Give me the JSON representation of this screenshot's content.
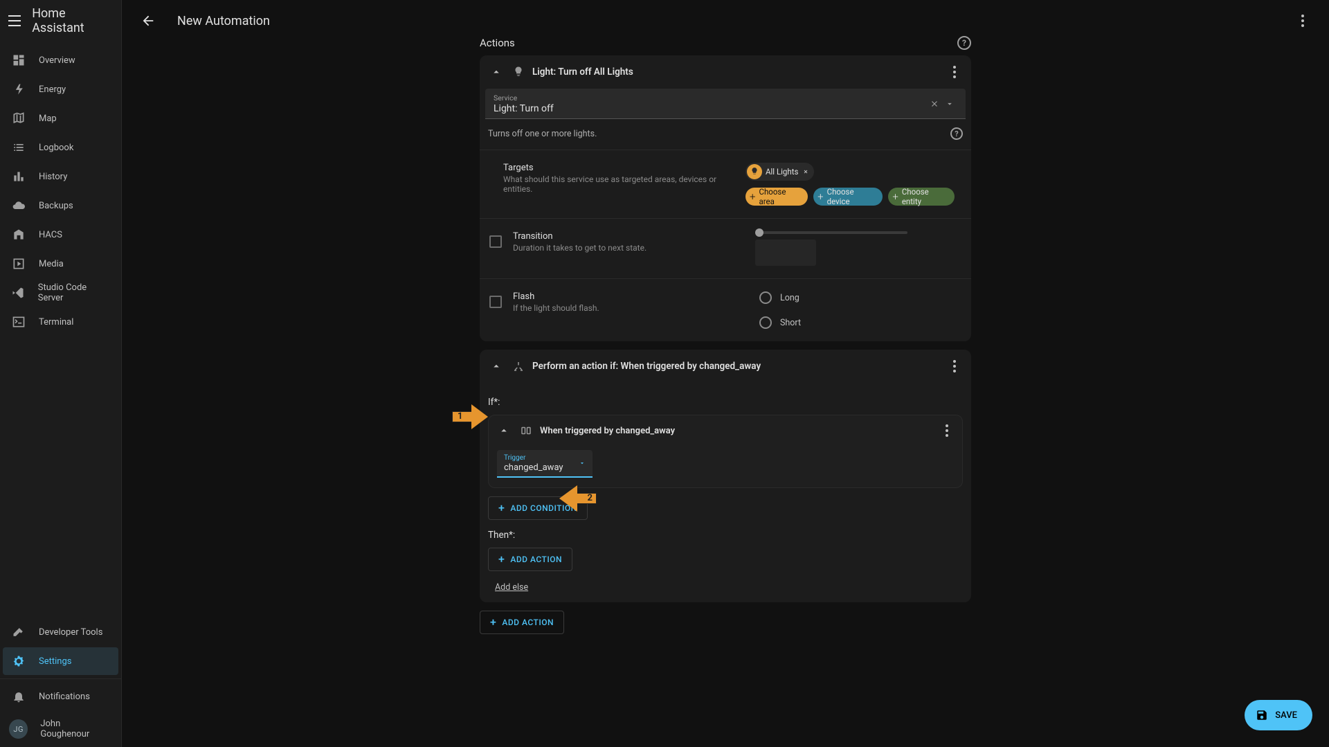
{
  "brand": "Home Assistant",
  "page_title": "New Automation",
  "sidebar": {
    "items": [
      {
        "label": "Overview"
      },
      {
        "label": "Energy"
      },
      {
        "label": "Map"
      },
      {
        "label": "Logbook"
      },
      {
        "label": "History"
      },
      {
        "label": "Backups"
      },
      {
        "label": "HACS"
      },
      {
        "label": "Media"
      },
      {
        "label": "Studio Code Server"
      },
      {
        "label": "Terminal"
      }
    ],
    "devtools": "Developer Tools",
    "settings": "Settings",
    "notifications": "Notifications",
    "user_initials": "JG",
    "user_name": "John Goughenour"
  },
  "section": {
    "title": "Actions"
  },
  "action1": {
    "title": "Light: Turn off All Lights",
    "service_label": "Service",
    "service_value": "Light: Turn off",
    "description": "Turns off one or more lights.",
    "targets_title": "Targets",
    "targets_sub": "What should this service use as targeted areas, devices or entities.",
    "target_chip": "All Lights",
    "choose_area": "Choose area",
    "choose_device": "Choose device",
    "choose_entity": "Choose entity",
    "transition_title": "Transition",
    "transition_sub": "Duration it takes to get to next state.",
    "flash_title": "Flash",
    "flash_sub": "If the light should flash.",
    "flash_long": "Long",
    "flash_short": "Short"
  },
  "action2": {
    "title": "Perform an action if: When triggered by changed_away",
    "if_label": "If*:",
    "inner_title": "When triggered by changed_away",
    "trigger_label": "Trigger",
    "trigger_value": "changed_away",
    "add_condition": "ADD CONDITION",
    "then_label": "Then*:",
    "add_action_inner": "ADD ACTION",
    "add_else": "Add else"
  },
  "add_action_outer": "ADD ACTION",
  "save": "SAVE",
  "annotations": {
    "arrow1": "1",
    "arrow2": "2"
  }
}
